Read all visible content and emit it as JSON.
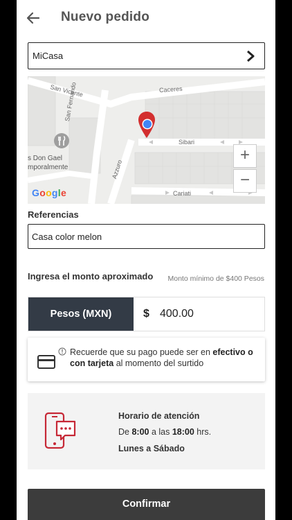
{
  "header": {
    "title": "Nuevo pedido",
    "back_icon": "arrow-left-icon"
  },
  "address": {
    "value": "MiCasa",
    "chevron_icon": "chevron-right-icon"
  },
  "map": {
    "streets": [
      "San Vicente",
      "Caceres",
      "San Fernando",
      "Sibari",
      "Azzuro",
      "Cariati"
    ],
    "poi_name": "s Don Gael",
    "poi_note": "mporalmente",
    "google_logo": "Google",
    "zoom_in": "+",
    "zoom_out": "−",
    "pin_color": "#d32f2f",
    "location_dot_color": "#4285f4"
  },
  "references": {
    "label": "Referencias",
    "value": "Casa color melon"
  },
  "amount": {
    "label": "Ingresa el monto aproximado",
    "minimum": "Monto mínimo de $400 Pesos",
    "currency": "Pesos (MXN)",
    "symbol": "$",
    "value": "400.00"
  },
  "notice": {
    "text_1": "Recuerde que su pago puede ser en ",
    "bold_1": "efectivo o con tarjeta",
    "text_2": " al momento del surtido"
  },
  "hours": {
    "title": "Horario de atención",
    "prefix": "De ",
    "start": "8:00",
    "middle": " a las ",
    "end": "18:00",
    "suffix": " hrs.",
    "days": "Lunes a Sábado",
    "icon_color": "#c62836"
  },
  "confirm_label": "Confirmar",
  "colors": {
    "currency_bg": "#333b46",
    "confirm_bg": "#3c3c3c"
  }
}
